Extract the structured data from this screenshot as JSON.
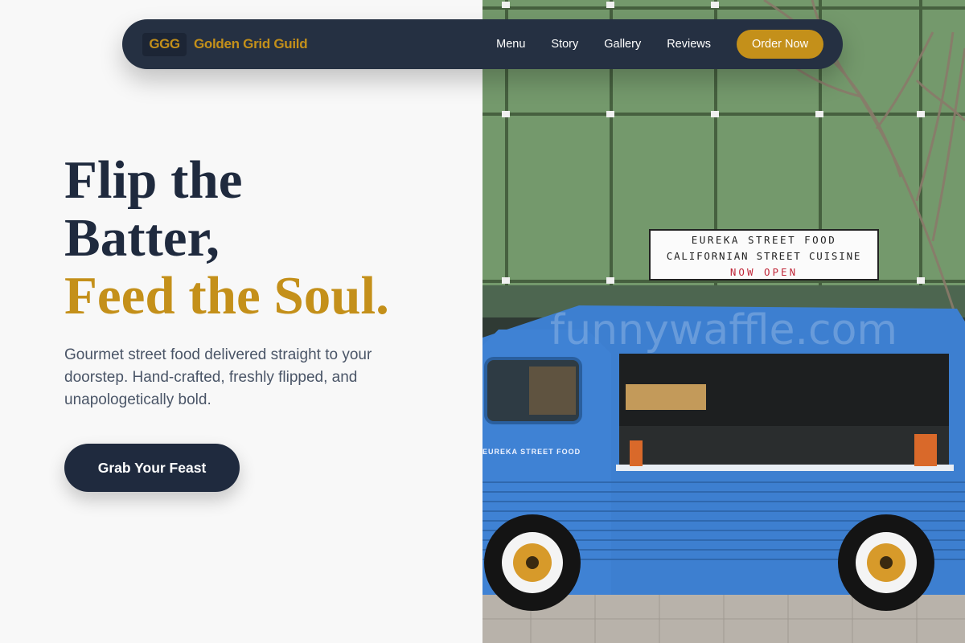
{
  "nav": {
    "logo": "GGG",
    "brand": "Golden Grid Guild",
    "links": [
      "Menu",
      "Story",
      "Gallery",
      "Reviews"
    ],
    "cta": "Order Now"
  },
  "hero": {
    "title_line1": "Flip the",
    "title_line2": "Batter,",
    "title_accent": "Feed the Soul.",
    "subtitle": "Gourmet street food delivered straight to your doorstep. Hand-crafted, freshly flipped, and unapologetically bold.",
    "cta": "Grab Your Feast"
  },
  "photo": {
    "sign_line1": "EUREKA STREET FOOD",
    "sign_line2": "CALIFORNIAN STREET CUISINE",
    "sign_line3": "NOW OPEN",
    "truck_label": "EUREKA STREET FOOD",
    "watermark": "funnywaffle.com"
  },
  "colors": {
    "accent": "#c4901a",
    "navy": "#1f2a3e",
    "nav_bg": "#253042",
    "truck_blue": "#3d7fd0"
  }
}
